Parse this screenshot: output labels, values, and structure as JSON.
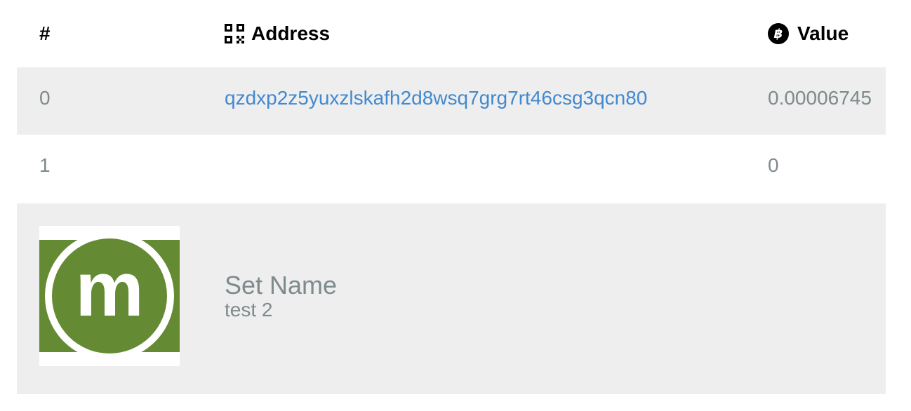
{
  "header": {
    "index_label": "#",
    "address_label": "Address",
    "value_label": "Value",
    "address_icon": "qr-code-icon",
    "value_icon": "bitcoin-icon"
  },
  "rows": [
    {
      "index": "0",
      "address": "qzdxp2z5yuxzlskafh2d8wsq7grg7rt46csg3qcn80",
      "value": "0.00006745"
    },
    {
      "index": "1",
      "address": "",
      "value": "0"
    }
  ],
  "profile": {
    "logo_icon": "memo-logo",
    "logo_letter": "m",
    "name": "Set Name",
    "subtitle": "test 2"
  },
  "colors": {
    "link": "#4289cf",
    "muted_text": "#7e8a8c",
    "row_shade": "#eeeeee",
    "logo_green": "#648b33"
  }
}
